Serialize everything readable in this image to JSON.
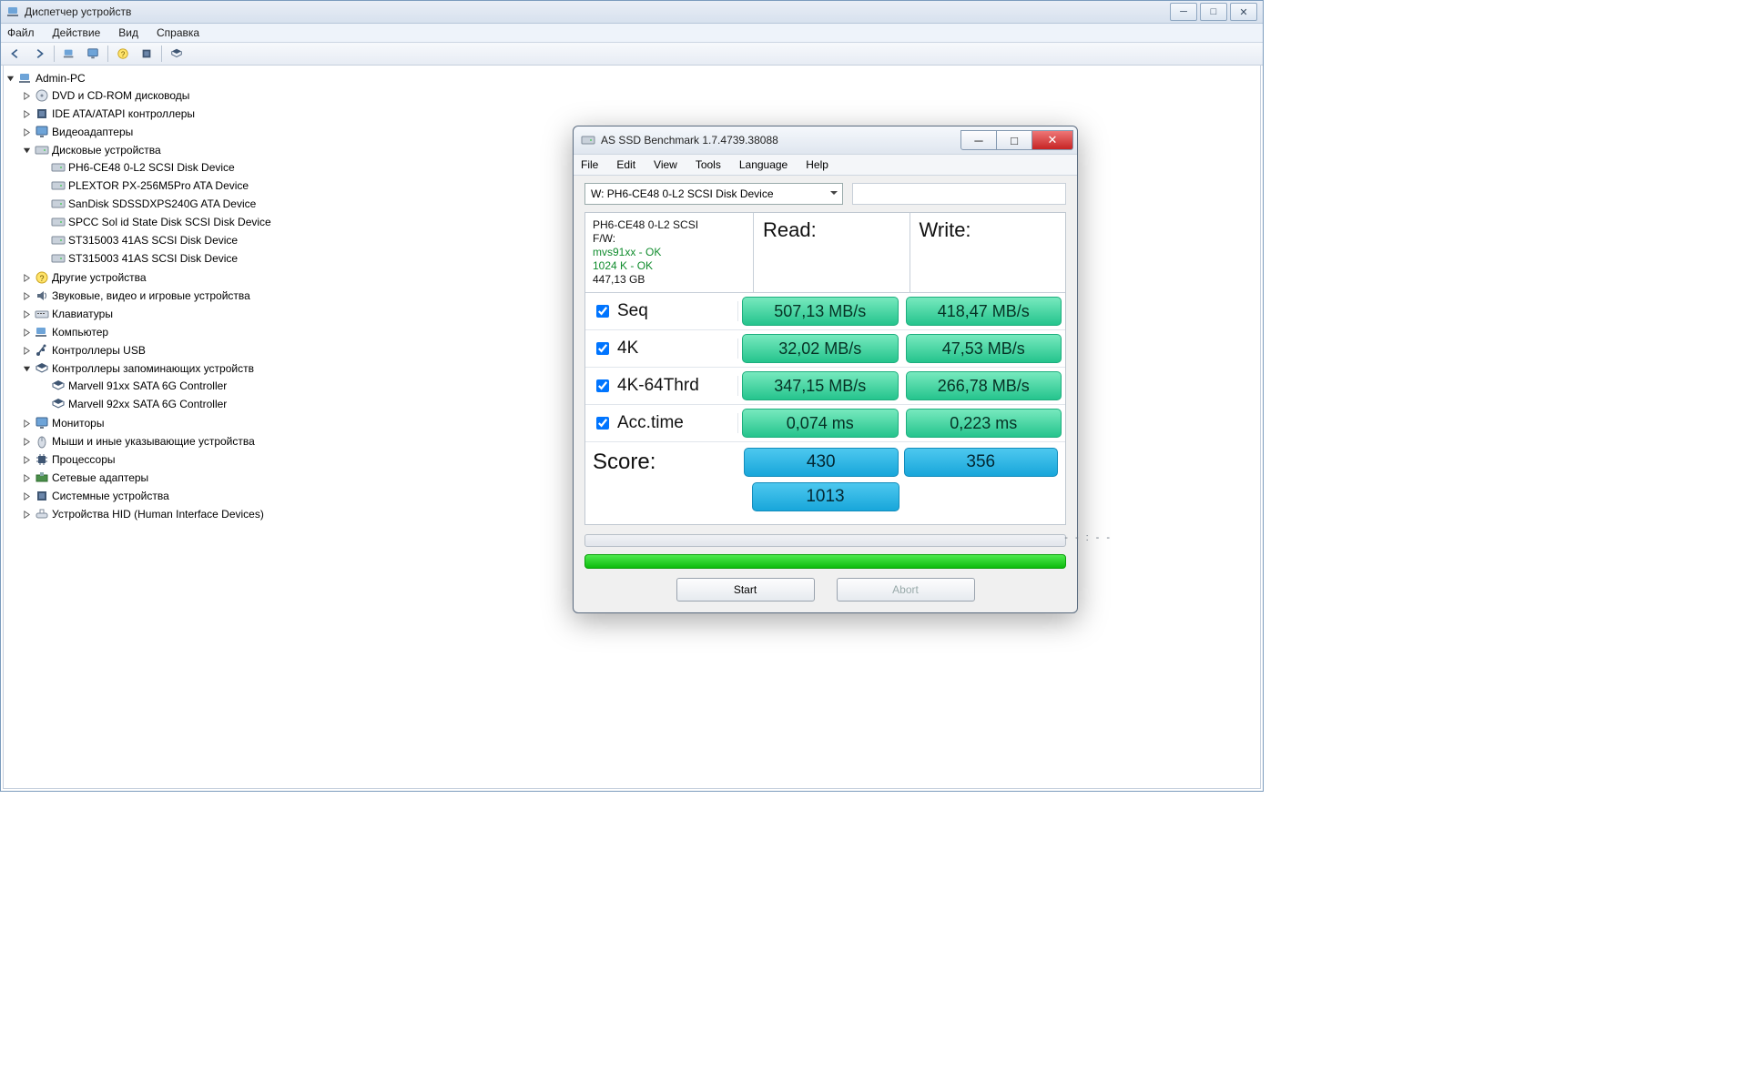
{
  "dm": {
    "title": "Диспетчер устройств",
    "menu": [
      "Файл",
      "Действие",
      "Вид",
      "Справка"
    ],
    "root": "Admin-PC",
    "cats": [
      {
        "label": "DVD и CD-ROM дисководы"
      },
      {
        "label": "IDE ATA/ATAPI контроллеры"
      },
      {
        "label": "Видеоадаптеры"
      },
      {
        "label": "Дисковые устройства",
        "open": true,
        "kids": [
          "PH6-CE48 0-L2 SCSI Disk Device",
          "PLEXTOR PX-256M5Pro ATA Device",
          "SanDisk SDSSDXPS240G ATA Device",
          "SPCC Sol id State Disk SCSI Disk Device",
          "ST315003 41AS SCSI Disk Device",
          "ST315003 41AS SCSI Disk Device"
        ]
      },
      {
        "label": "Другие устройства"
      },
      {
        "label": "Звуковые, видео и игровые устройства"
      },
      {
        "label": "Клавиатуры"
      },
      {
        "label": "Компьютер"
      },
      {
        "label": "Контроллеры USB"
      },
      {
        "label": "Контроллеры запоминающих устройств",
        "open": true,
        "kids": [
          "Marvell 91xx SATA 6G Controller",
          "Marvell 92xx SATA 6G Controller"
        ]
      },
      {
        "label": "Мониторы"
      },
      {
        "label": "Мыши и иные указывающие устройства"
      },
      {
        "label": "Процессоры"
      },
      {
        "label": "Сетевые адаптеры"
      },
      {
        "label": "Системные устройства"
      },
      {
        "label": "Устройства HID (Human Interface Devices)"
      }
    ]
  },
  "as": {
    "title": "AS SSD Benchmark 1.7.4739.38088",
    "menu": {
      "file": "File",
      "edit": "Edit",
      "view": "View",
      "tools": "Tools",
      "lang": "Language",
      "help": "Help"
    },
    "device": "W: PH6-CE48 0-L2 SCSI Disk Device",
    "info": {
      "name": "PH6-CE48 0-L2 SCSI",
      "fw_label": "F/W:",
      "drv": "mvs91xx - OK",
      "align": "1024 K - OK",
      "size": "447,13 GB"
    },
    "readcol": "Read:",
    "writecol": "Write:",
    "rows": {
      "seq": {
        "label": "Seq",
        "r": "507,13 MB/s",
        "w": "418,47 MB/s"
      },
      "k4": {
        "label": "4K",
        "r": "32,02 MB/s",
        "w": "47,53 MB/s"
      },
      "k4t": {
        "label": "4K-64Thrd",
        "r": "347,15 MB/s",
        "w": "266,78 MB/s"
      },
      "acc": {
        "label": "Acc.time",
        "r": "0,074 ms",
        "w": "0,223 ms"
      }
    },
    "score": {
      "label": "Score:",
      "r": "430",
      "w": "356",
      "total": "1013"
    },
    "timer": "--:--",
    "start": "Start",
    "abort": "Abort"
  }
}
